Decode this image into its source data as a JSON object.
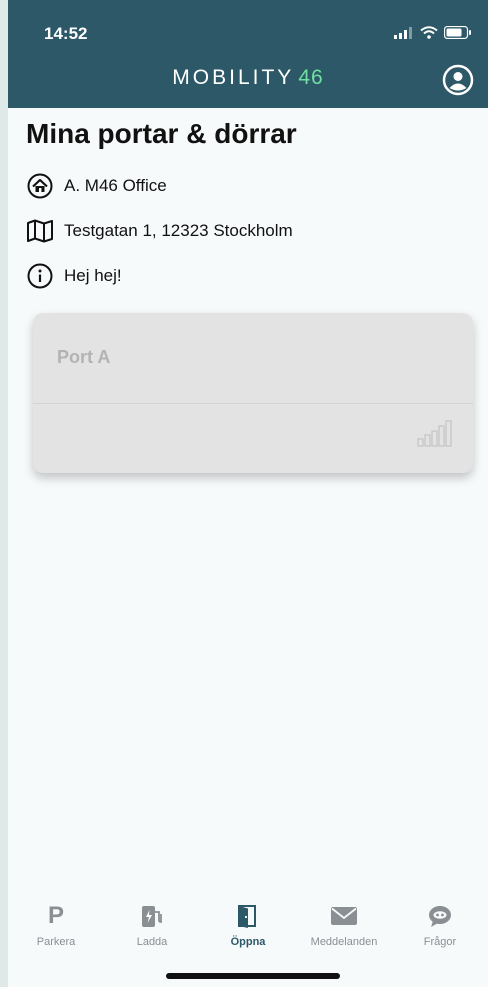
{
  "status_bar": {
    "time": "14:52"
  },
  "header": {
    "brand_text": "MOBILITY",
    "brand_number": "46",
    "profile_icon": "user-circle-icon",
    "colors": {
      "background": "#2d5868",
      "accent": "#6fe0a0"
    }
  },
  "page": {
    "title": "Mina portar & dörrar",
    "info": [
      {
        "icon": "home-icon",
        "text": "A. M46 Office"
      },
      {
        "icon": "map-icon",
        "text": "Testgatan 1, 12323 Stockholm"
      },
      {
        "icon": "info-icon",
        "text": "Hej hej!"
      }
    ]
  },
  "card": {
    "title": "Port A",
    "icon": "signal-strength-icon"
  },
  "tabbar": {
    "items": [
      {
        "label": "Parkera",
        "icon": "parking-icon",
        "active": false
      },
      {
        "label": "Ladda",
        "icon": "charging-icon",
        "active": false
      },
      {
        "label": "Öppna",
        "icon": "door-icon",
        "active": true
      },
      {
        "label": "Meddelanden",
        "icon": "mail-icon",
        "active": false
      },
      {
        "label": "Frågor",
        "icon": "chat-bot-icon",
        "active": false
      }
    ]
  }
}
